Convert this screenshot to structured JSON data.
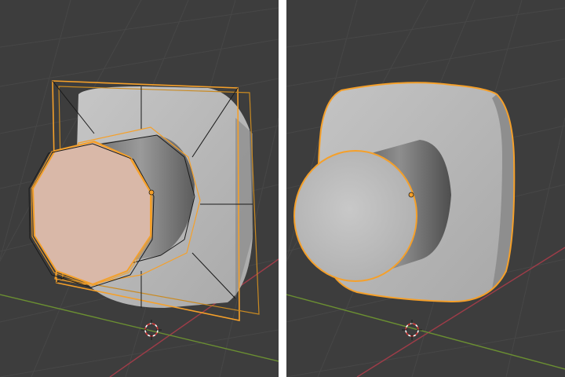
{
  "viewports": [
    {
      "id": "left",
      "label": "",
      "display": "wireframe-overlay",
      "origin_icon": "world-origin-cursor-icon",
      "object_origin_icon": "object-origin-icon",
      "selection": "active-selection"
    },
    {
      "id": "right",
      "label": "",
      "display": "solid-smooth",
      "origin_icon": "world-origin-cursor-icon",
      "object_origin_icon": "object-origin-icon",
      "selection": "active-selection"
    }
  ],
  "colors": {
    "background": "#3d3d3d",
    "grid": "#474747",
    "x_axis": "#9e3c48",
    "y_axis": "#6b8f32",
    "selection_orange": "#f5a02a",
    "mesh_light": "#b8b8b8",
    "mesh_mid": "#9a9a9a",
    "mesh_dark": "#5a5a5a",
    "active_face": "#d9b8a8",
    "wire": "#1a1a1a"
  }
}
